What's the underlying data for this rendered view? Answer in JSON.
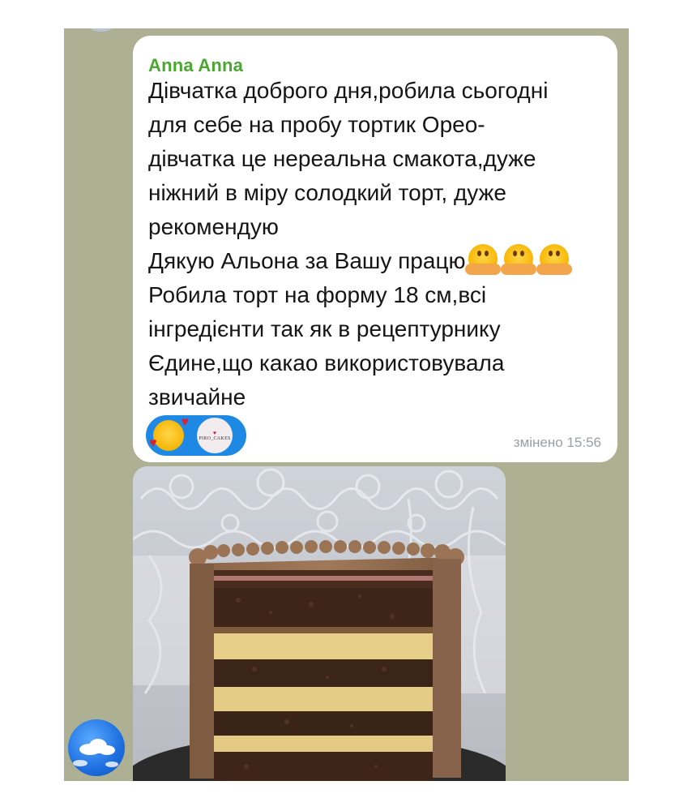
{
  "message": {
    "sender": "Anna Anna",
    "lines": [
      "Дівчатка доброго дня,робила сьогодні",
      "для себе на пробу тортик Орео-",
      "дівчатка це нереальна смакота,дуже",
      "ніжний в міру солодкий торт, дуже",
      "рекомендую",
      "Дякую Альона за Вашу працю",
      "Робила торт на форму 18 см,всі",
      "інгредієнти так як в рецептурнику",
      "Єдине,що какао використовувала",
      "звичайне"
    ],
    "reaction_avatar_label": "PIRO_CAKES",
    "timestamp": "змінено 15:56"
  },
  "icons": {
    "hug_emoji": "hugging-face-icon",
    "reaction_emoji": "smiling-face-with-hearts-icon",
    "sender_avatar": "cloud-sky-avatar"
  },
  "colors": {
    "chat_background": "#aeb094",
    "sender_name": "#4aa72f",
    "reaction_pill": "#1e88e5",
    "timestamp": "#9aa0a6"
  }
}
